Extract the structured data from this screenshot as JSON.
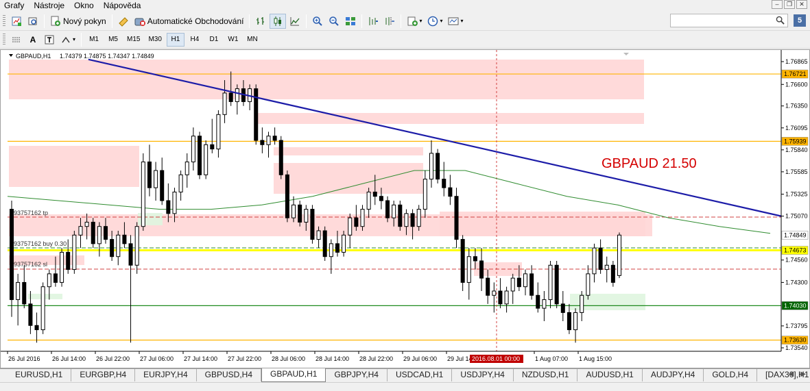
{
  "menu": [
    "Grafy",
    "Nástroje",
    "Okno",
    "Nápověda"
  ],
  "window_controls": [
    "–",
    "❐",
    "✕"
  ],
  "toolbar": {
    "new_order_label": "Nový pokyn",
    "autotrading_label": "Automatické Obchodování"
  },
  "search": {
    "placeholder": "",
    "value": ""
  },
  "timeframes": [
    "M1",
    "M5",
    "M15",
    "M30",
    "H1",
    "H4",
    "D1",
    "W1",
    "MN"
  ],
  "active_timeframe": "H1",
  "chart_header": {
    "symbol_tf": "GBPAUD,H1",
    "ohlc": "1.74379 1.74875 1.74347 1.74849"
  },
  "annotation": {
    "text": "GBPAUD 21.50",
    "color": "#d40000"
  },
  "trade_lines": [
    {
      "label": "#93757162 tp"
    },
    {
      "label": "#93757162 buy 0.30"
    },
    {
      "label": "#93757162 sl"
    }
  ],
  "price_axis": {
    "ticks": [
      "1.76865",
      "1.76600",
      "1.76350",
      "1.76095",
      "1.75840",
      "1.75585",
      "1.75325",
      "1.75070",
      "1.74560",
      "1.74300",
      "1.73795",
      "1.73540"
    ],
    "tags": [
      {
        "text": "1.76721",
        "bg": "#ffb400"
      },
      {
        "text": "1.75939",
        "bg": "#ffb400"
      },
      {
        "text": "1.74849",
        "bg": "#ffffff"
      },
      {
        "text": "1.74673",
        "bg": "#ffff00"
      },
      {
        "text": "1.74030",
        "bg": "#006400"
      },
      {
        "text": "1.73630",
        "bg": "#ffb400"
      }
    ]
  },
  "time_axis": {
    "labels": [
      "26 Jul 2016",
      "26 Jul 14:00",
      "26 Jul 22:00",
      "27 Jul 06:00",
      "27 Jul 14:00",
      "27 Jul 22:00",
      "28 Jul 06:00",
      "28 Jul 14:00",
      "28 Jul 22:00",
      "29 Jul 06:00",
      "29 Jul 14:00",
      "1 Aug 07:00",
      "1 Aug 15:00"
    ],
    "crosshair_label": "2016.08.01 00:00"
  },
  "colors": {
    "trendline": "#1c1ca8",
    "resistance": "#ffb400",
    "support": "#1e8a1e",
    "entry_line": "#ffff00",
    "ma": "#2e8b2e",
    "zone_red": "#ffd6d6",
    "zone_green": "#dff5df"
  },
  "chart_data": {
    "type": "candlestick",
    "symbol": "GBPAUD",
    "timeframe": "H1",
    "ylim": [
      1.735,
      1.77
    ],
    "horizontal_levels": [
      1.76721,
      1.75939,
      1.74673,
      1.7403,
      1.7363
    ],
    "ohlc": [
      [
        1.7515,
        1.7525,
        1.739,
        1.741
      ],
      [
        1.741,
        1.744,
        1.738,
        1.743
      ],
      [
        1.743,
        1.745,
        1.74,
        1.7405
      ],
      [
        1.7405,
        1.742,
        1.737,
        1.738
      ],
      [
        1.738,
        1.7395,
        1.736,
        1.7375
      ],
      [
        1.7375,
        1.743,
        1.737,
        1.7425
      ],
      [
        1.7425,
        1.7445,
        1.741,
        1.744
      ],
      [
        1.744,
        1.746,
        1.7425,
        1.743
      ],
      [
        1.743,
        1.747,
        1.7425,
        1.7465
      ],
      [
        1.7465,
        1.748,
        1.744,
        1.7445
      ],
      [
        1.7445,
        1.749,
        1.744,
        1.7485
      ],
      [
        1.7485,
        1.7505,
        1.747,
        1.7495
      ],
      [
        1.7495,
        1.751,
        1.748,
        1.75
      ],
      [
        1.75,
        1.7505,
        1.747,
        1.7475
      ],
      [
        1.7475,
        1.75,
        1.746,
        1.7495
      ],
      [
        1.7495,
        1.7505,
        1.7475,
        1.748
      ],
      [
        1.748,
        1.749,
        1.7455,
        1.746
      ],
      [
        1.746,
        1.749,
        1.745,
        1.7485
      ],
      [
        1.7485,
        1.75,
        1.747,
        1.7475
      ],
      [
        1.7475,
        1.7485,
        1.736,
        1.745
      ],
      [
        1.745,
        1.75,
        1.744,
        1.7495
      ],
      [
        1.7495,
        1.758,
        1.749,
        1.757
      ],
      [
        1.757,
        1.759,
        1.753,
        1.754
      ],
      [
        1.754,
        1.757,
        1.7525,
        1.756
      ],
      [
        1.756,
        1.7575,
        1.752,
        1.7525
      ],
      [
        1.7525,
        1.7545,
        1.75,
        1.751
      ],
      [
        1.751,
        1.754,
        1.75,
        1.7535
      ],
      [
        1.7535,
        1.756,
        1.7525,
        1.7555
      ],
      [
        1.7555,
        1.758,
        1.754,
        1.757
      ],
      [
        1.757,
        1.761,
        1.756,
        1.76
      ],
      [
        1.76,
        1.7605,
        1.755,
        1.7555
      ],
      [
        1.7555,
        1.7595,
        1.755,
        1.759
      ],
      [
        1.759,
        1.762,
        1.758,
        1.7585
      ],
      [
        1.7585,
        1.763,
        1.7575,
        1.7625
      ],
      [
        1.7625,
        1.7665,
        1.7615,
        1.765
      ],
      [
        1.765,
        1.7675,
        1.7635,
        1.764
      ],
      [
        1.764,
        1.766,
        1.7625,
        1.7655
      ],
      [
        1.7655,
        1.7665,
        1.7635,
        1.764
      ],
      [
        1.764,
        1.766,
        1.763,
        1.7655
      ],
      [
        1.7655,
        1.766,
        1.759,
        1.7595
      ],
      [
        1.7595,
        1.761,
        1.758,
        1.759
      ],
      [
        1.759,
        1.7605,
        1.7575,
        1.76
      ],
      [
        1.76,
        1.761,
        1.759,
        1.7595
      ],
      [
        1.7595,
        1.76,
        1.755,
        1.7555
      ],
      [
        1.7555,
        1.756,
        1.75,
        1.7505
      ],
      [
        1.7505,
        1.753,
        1.75,
        1.752
      ],
      [
        1.752,
        1.7525,
        1.7495,
        1.75
      ],
      [
        1.75,
        1.752,
        1.749,
        1.7515
      ],
      [
        1.7515,
        1.752,
        1.7475,
        1.748
      ],
      [
        1.748,
        1.7495,
        1.747,
        1.749
      ],
      [
        1.749,
        1.7495,
        1.7455,
        1.746
      ],
      [
        1.746,
        1.748,
        1.744,
        1.7475
      ],
      [
        1.7475,
        1.749,
        1.746,
        1.7465
      ],
      [
        1.7465,
        1.749,
        1.746,
        1.7485
      ],
      [
        1.7485,
        1.751,
        1.747,
        1.7505
      ],
      [
        1.7505,
        1.752,
        1.749,
        1.7495
      ],
      [
        1.7495,
        1.752,
        1.749,
        1.7515
      ],
      [
        1.7515,
        1.754,
        1.7505,
        1.7535
      ],
      [
        1.7535,
        1.7555,
        1.752,
        1.753
      ],
      [
        1.753,
        1.754,
        1.7515,
        1.7525
      ],
      [
        1.7525,
        1.753,
        1.75,
        1.7505
      ],
      [
        1.7505,
        1.7525,
        1.7495,
        1.752
      ],
      [
        1.752,
        1.7525,
        1.749,
        1.7495
      ],
      [
        1.7495,
        1.7515,
        1.7485,
        1.751
      ],
      [
        1.751,
        1.7515,
        1.748,
        1.7495
      ],
      [
        1.7495,
        1.752,
        1.749,
        1.7515
      ],
      [
        1.7515,
        1.756,
        1.7505,
        1.755
      ],
      [
        1.755,
        1.7595,
        1.754,
        1.758
      ],
      [
        1.758,
        1.7585,
        1.7545,
        1.755
      ],
      [
        1.755,
        1.757,
        1.753,
        1.754
      ],
      [
        1.754,
        1.7555,
        1.752,
        1.753
      ],
      [
        1.753,
        1.754,
        1.747,
        1.748
      ],
      [
        1.748,
        1.7485,
        1.742,
        1.743
      ],
      [
        1.743,
        1.747,
        1.741,
        1.746
      ],
      [
        1.746,
        1.747,
        1.7445,
        1.7455
      ],
      [
        1.7455,
        1.747,
        1.742,
        1.7435
      ],
      [
        1.7435,
        1.7445,
        1.7405,
        1.7415
      ],
      [
        1.7415,
        1.743,
        1.7395,
        1.742
      ],
      [
        1.742,
        1.7435,
        1.74,
        1.7405
      ],
      [
        1.7405,
        1.7425,
        1.7395,
        1.742
      ],
      [
        1.742,
        1.744,
        1.7405,
        1.7435
      ],
      [
        1.7435,
        1.745,
        1.742,
        1.7425
      ],
      [
        1.7425,
        1.7445,
        1.7415,
        1.744
      ],
      [
        1.744,
        1.745,
        1.741,
        1.7415
      ],
      [
        1.7415,
        1.743,
        1.7395,
        1.74
      ],
      [
        1.74,
        1.742,
        1.7385,
        1.741
      ],
      [
        1.741,
        1.7455,
        1.74,
        1.745
      ],
      [
        1.745,
        1.7455,
        1.74,
        1.7405
      ],
      [
        1.7405,
        1.742,
        1.7385,
        1.7395
      ],
      [
        1.7395,
        1.7405,
        1.737,
        1.7375
      ],
      [
        1.7375,
        1.74,
        1.736,
        1.7395
      ],
      [
        1.7395,
        1.742,
        1.7385,
        1.7415
      ],
      [
        1.7415,
        1.745,
        1.741,
        1.744
      ],
      [
        1.744,
        1.7475,
        1.743,
        1.747
      ],
      [
        1.747,
        1.748,
        1.744,
        1.7445
      ],
      [
        1.7445,
        1.746,
        1.743,
        1.745
      ],
      [
        1.745,
        1.7455,
        1.7425,
        1.743
      ],
      [
        1.7438,
        1.7488,
        1.7435,
        1.7485
      ]
    ],
    "ma": [
      1.753,
      1.7525,
      1.752,
      1.7515,
      1.7515,
      1.752,
      1.753,
      1.7545,
      1.756,
      1.756,
      1.7545,
      1.753,
      1.752,
      1.7505,
      1.7495,
      1.7487
    ],
    "trendline": {
      "from_index": 14,
      "from_price": 1.7689,
      "to_price": 1.7507
    }
  }
}
